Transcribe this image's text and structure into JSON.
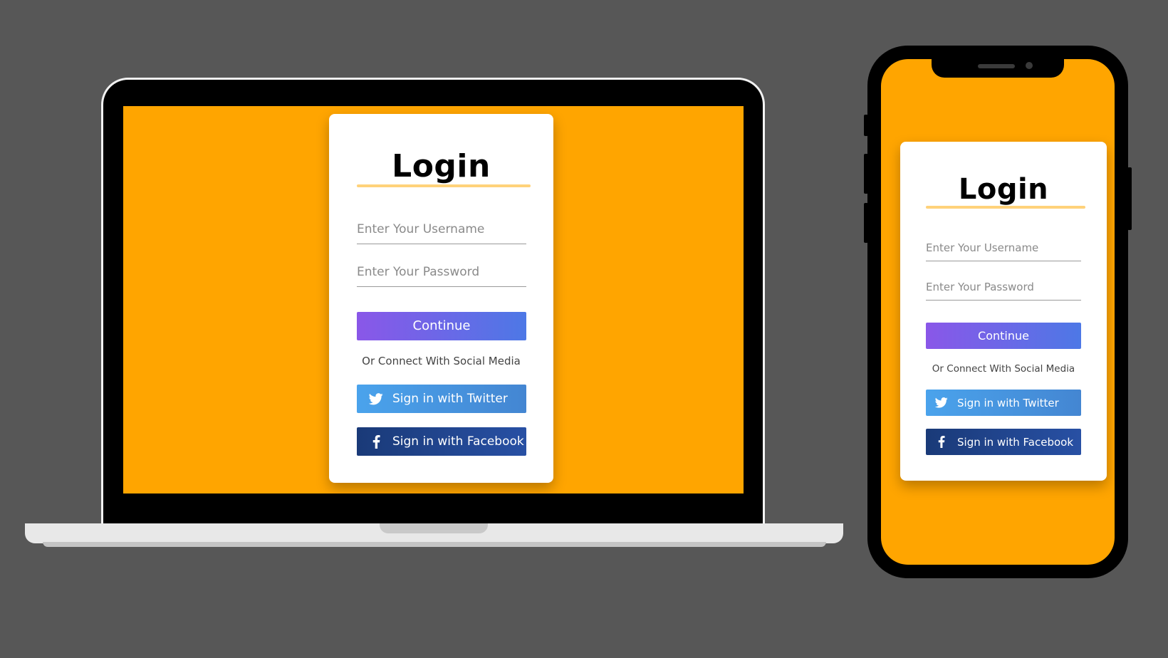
{
  "colors": {
    "background": "#575757",
    "screen": "#ffa500",
    "accent_underline": "#ffd27a",
    "continue_gradient": [
      "#8a57e8",
      "#4d78e6"
    ],
    "twitter": "#4aa3ec",
    "facebook": "#1a3a78"
  },
  "laptop": {
    "login": {
      "title": "Login",
      "username_placeholder": "Enter Your Username",
      "password_placeholder": "Enter Your Password",
      "continue_label": "Continue",
      "social_text": "Or Connect With Social Media",
      "twitter_label": "Sign in with Twitter",
      "facebook_label": "Sign in with Facebook",
      "twitter_icon": "twitter-bird-icon",
      "facebook_icon": "facebook-f-icon"
    }
  },
  "phone": {
    "login": {
      "title": "Login",
      "username_placeholder": "Enter Your Username",
      "password_placeholder": "Enter Your Password",
      "continue_label": "Continue",
      "social_text": "Or Connect With Social Media",
      "twitter_label": "Sign in with Twitter",
      "facebook_label": "Sign in with Facebook",
      "twitter_icon": "twitter-bird-icon",
      "facebook_icon": "facebook-f-icon"
    }
  }
}
